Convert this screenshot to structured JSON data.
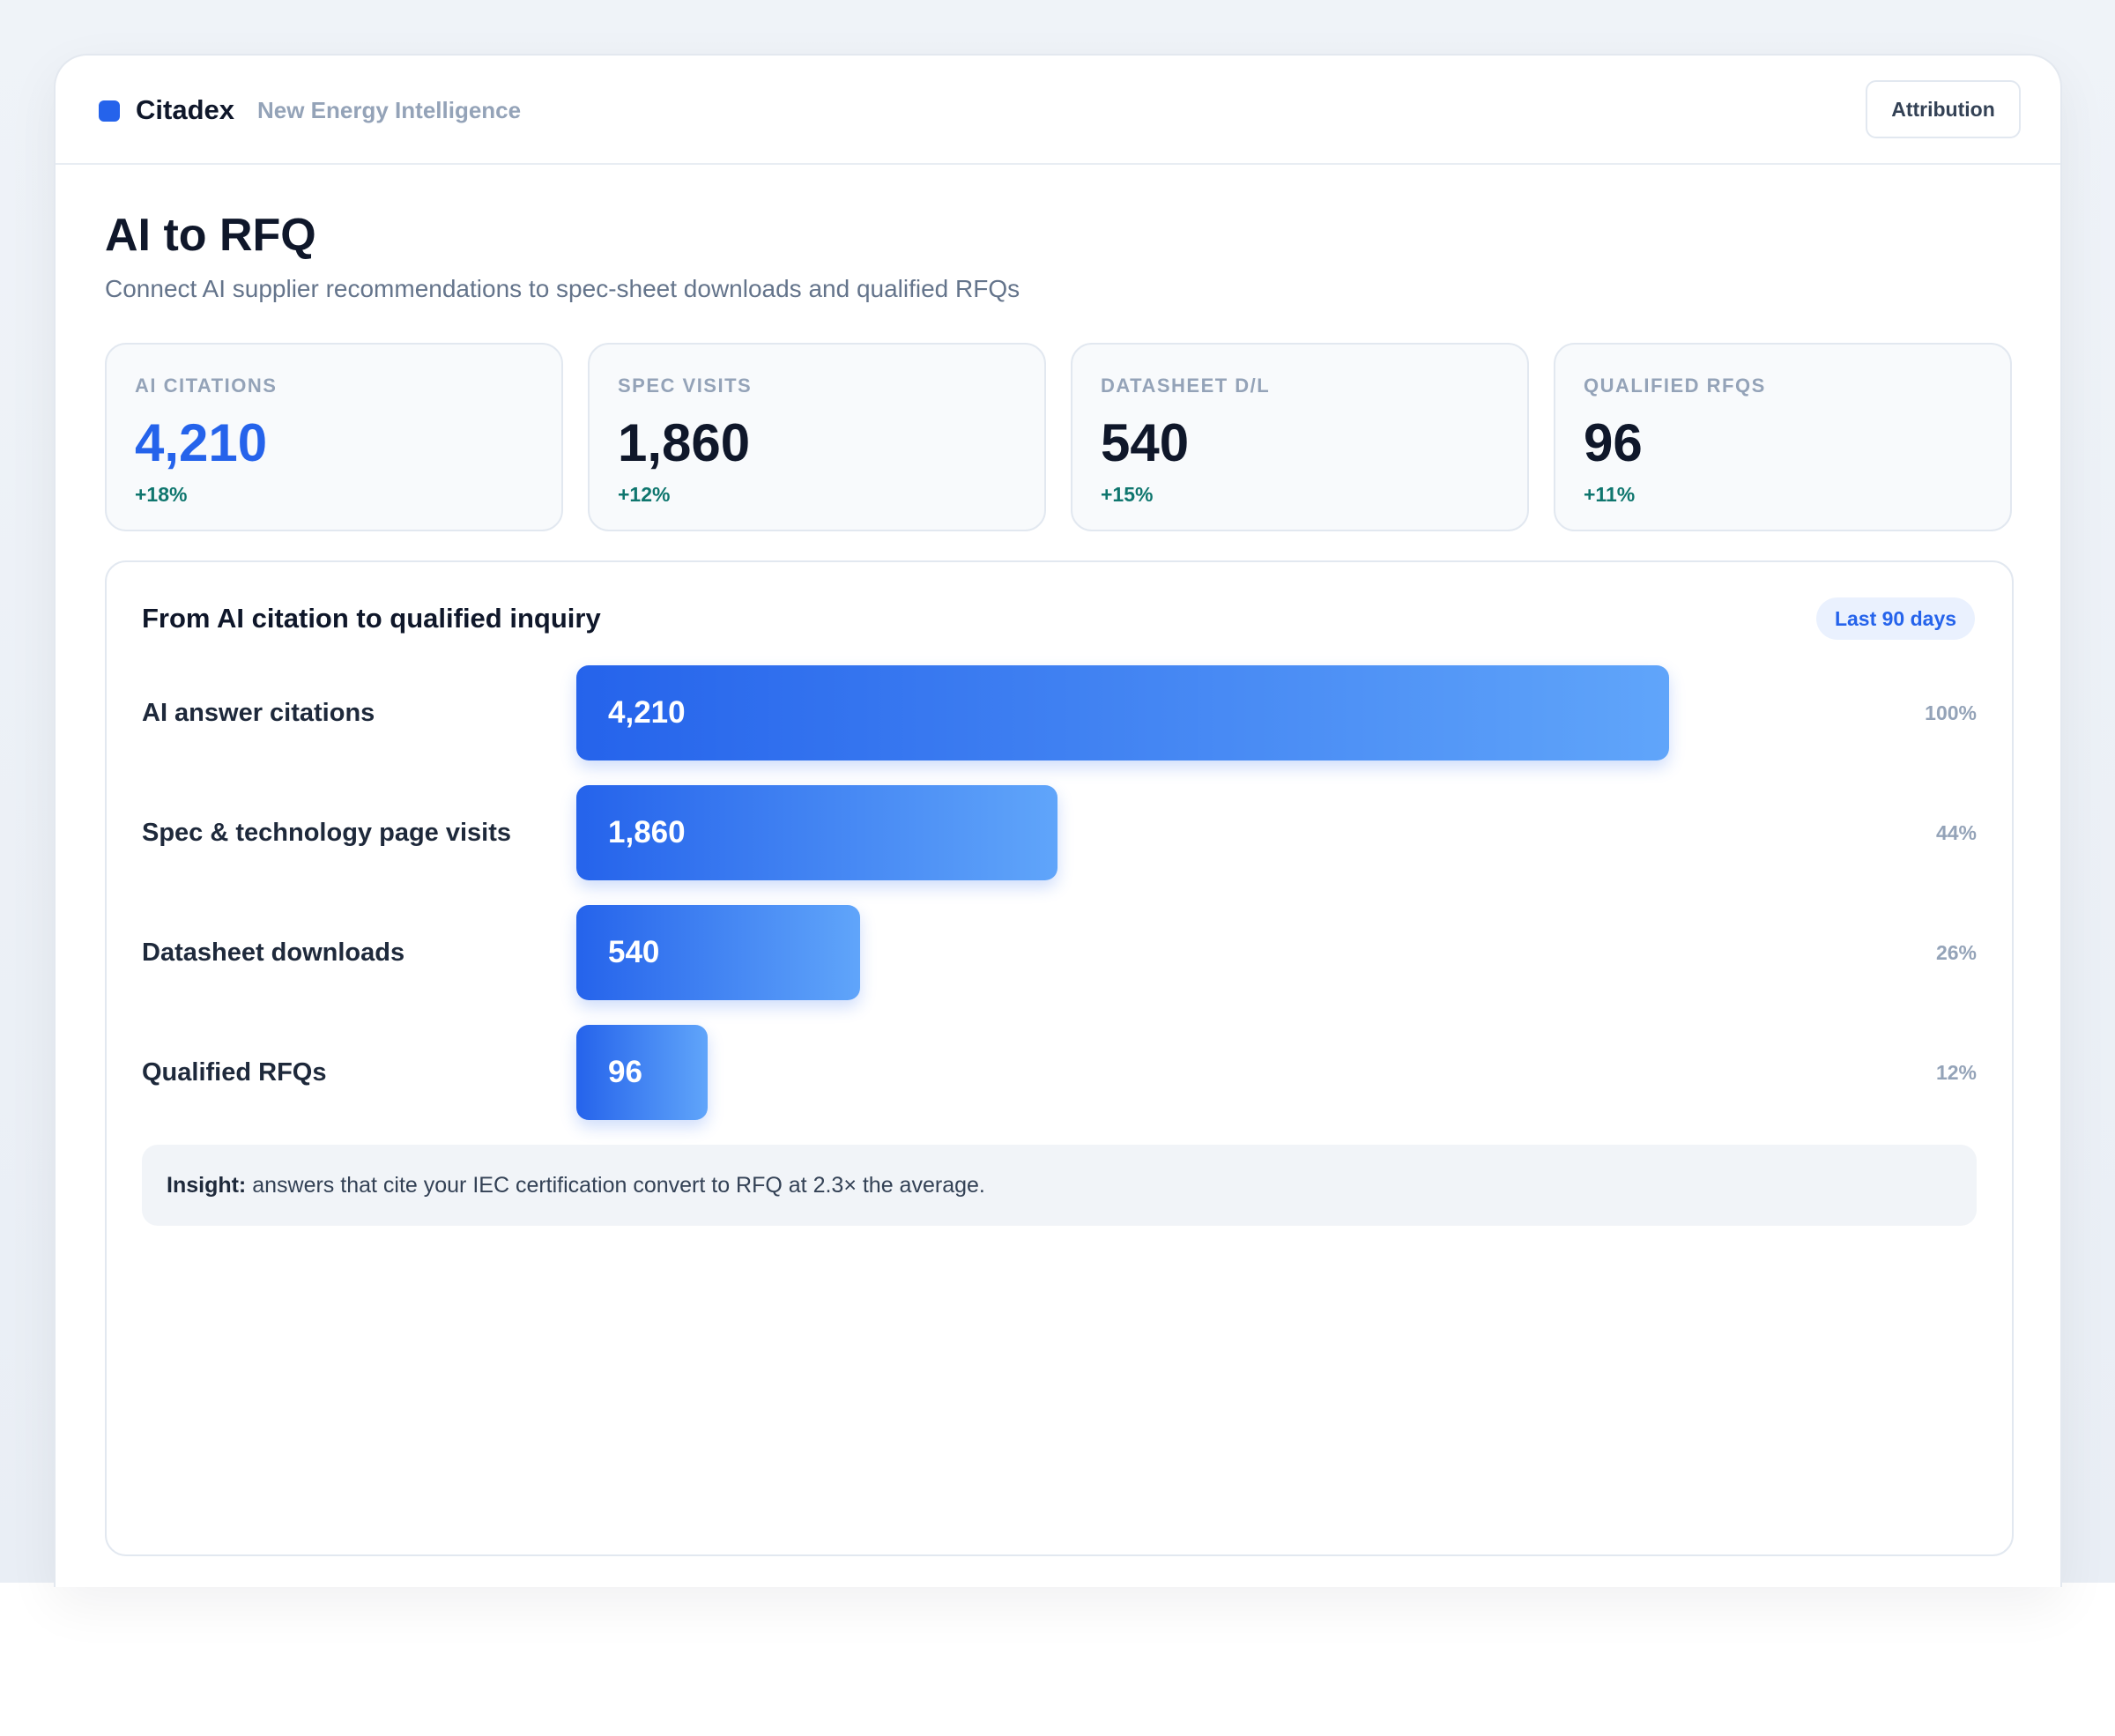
{
  "header": {
    "brand": "Citadex",
    "subtitle": "New Energy Intelligence",
    "attribution_label": "Attribution"
  },
  "page": {
    "title": "AI to RFQ",
    "subtitle": "Connect AI supplier recommendations to spec-sheet downloads and qualified RFQs"
  },
  "kpis": [
    {
      "label": "AI CITATIONS",
      "value": "4,210",
      "delta": "+18%"
    },
    {
      "label": "SPEC VISITS",
      "value": "1,860",
      "delta": "+12%"
    },
    {
      "label": "DATASHEET D/L",
      "value": "540",
      "delta": "+15%"
    },
    {
      "label": "QUALIFIED RFQS",
      "value": "96",
      "delta": "+11%"
    }
  ],
  "funnel": {
    "title": "From AI citation to qualified inquiry",
    "range_label": "Last 90 days",
    "insight_label": "Insight:",
    "insight_text": " answers that cite your IEC certification convert to RFQ at 2.3× the average."
  },
  "colors": {
    "accent": "#2563eb",
    "bar_end": "#60a5fa",
    "positive": "#0f766e"
  },
  "chart_data": {
    "type": "bar",
    "orientation": "horizontal",
    "categories": [
      "AI answer citations",
      "Spec & technology page visits",
      "Datasheet downloads",
      "Qualified RFQs"
    ],
    "values": [
      4210,
      1860,
      540,
      96
    ],
    "value_labels": [
      "4,210",
      "1,860",
      "540",
      "96"
    ],
    "percent_labels": [
      "100%",
      "44%",
      "26%",
      "12%"
    ],
    "bar_fill_fraction": [
      1.0,
      0.44,
      0.26,
      0.12
    ]
  }
}
